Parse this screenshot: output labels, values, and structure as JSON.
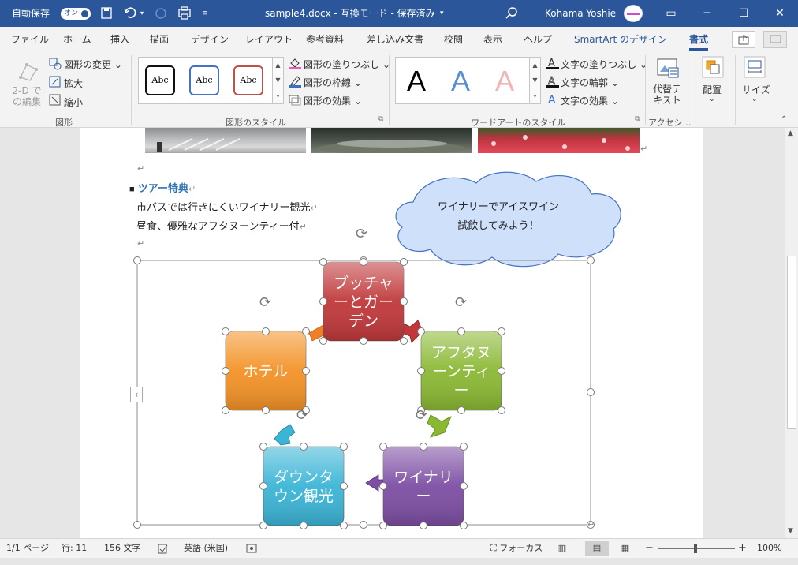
{
  "titlebar": {
    "autosave_label": "自動保存",
    "autosave_state": "オン",
    "document_title": "sample4.docx - 互換モード - 保存済み",
    "user_name": "Kohama Yoshie"
  },
  "tabs": [
    "ファイル",
    "ホーム",
    "挿入",
    "描画",
    "デザイン",
    "レイアウト",
    "参考資料",
    "差し込み文書",
    "校閲",
    "表示",
    "ヘルプ",
    "SmartArt のデザイン",
    "書式"
  ],
  "ribbon": {
    "shapes": {
      "edit2d": "2-D での編集",
      "change_shape": "図形の変更",
      "larger": "拡大",
      "smaller": "縮小",
      "group": "図形"
    },
    "shape_styles": {
      "gallery": [
        "Abc",
        "Abc",
        "Abc"
      ],
      "fill": "図形の塗りつぶし",
      "outline": "図形の枠線",
      "effects": "図形の効果",
      "group": "図形のスタイル"
    },
    "wordart": {
      "gallery": [
        "A",
        "A",
        "A"
      ],
      "text_fill": "文字の塗りつぶし",
      "text_outline": "文字の輪郭",
      "text_effects": "文字の効果",
      "group": "ワードアートのスタイル"
    },
    "accessibility": {
      "alt_text": "代替テキスト",
      "group": "アクセシ…"
    },
    "arrange": "配置",
    "size": "サイズ"
  },
  "document": {
    "heading": "ツアー特典",
    "line1": "市バスでは行きにくいワイナリー観光",
    "line2": "昼食、優雅なアフタヌーンティー付",
    "callout_line1": "ワイナリーでアイスワイン",
    "callout_line2": "試飲してみよう！",
    "smartart": {
      "nodes": [
        {
          "label": [
            "ブッチャ",
            "ーとガー",
            "デン"
          ],
          "color": "#c0383a"
        },
        {
          "label": [
            "アフタヌ",
            "ーンティ",
            "ー"
          ],
          "color": "#8ab833"
        },
        {
          "label": [
            "ワイナリ",
            "ー"
          ],
          "color": "#7d4ea3"
        },
        {
          "label": [
            "ダウンタ",
            "ウン観光"
          ],
          "color": "#3bb5d6"
        },
        {
          "label": [
            "ホテル"
          ],
          "color": "#f39226"
        }
      ]
    }
  },
  "status": {
    "page": "1/1 ページ",
    "line": "行: 11",
    "words": "156 文字",
    "language": "英語 (米国)",
    "focus": "フォーカス",
    "zoom": "100%"
  }
}
